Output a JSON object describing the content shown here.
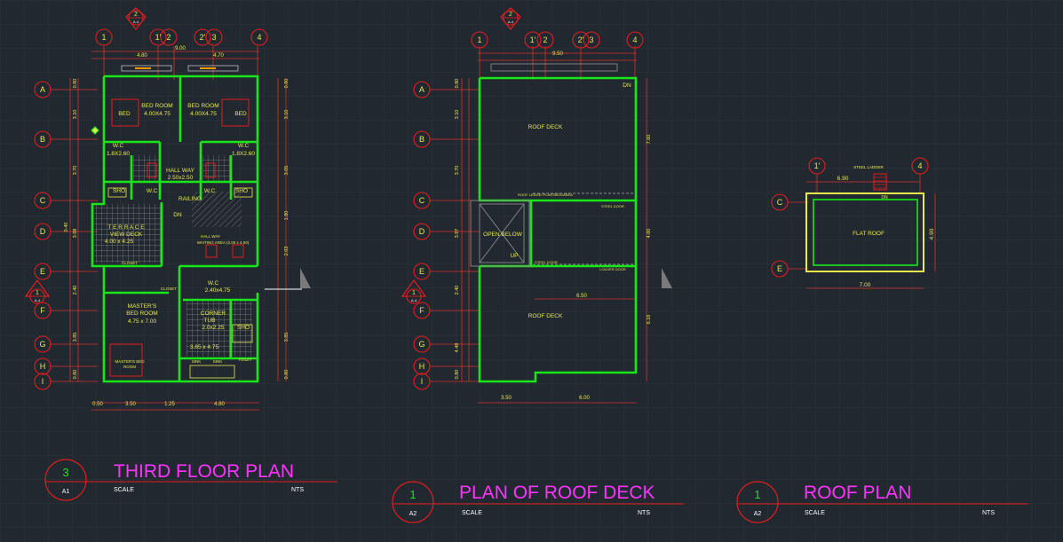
{
  "colors": {
    "background": "#212830",
    "grid": "#2c343d",
    "wall": "#19e619",
    "dimension": "#d4342a",
    "dim_text": "#e8e850",
    "bubble": "#e41d1d",
    "title": "#ff33ff",
    "white": "#ffffff",
    "flat_roof_outline": "#e8e850",
    "hatch": "#8a8a8a"
  },
  "third_floor": {
    "title_number": "3",
    "sheet": "A1",
    "title": "THIRD FLOOR PLAN",
    "scale_label": "SCALE",
    "scale_value": "NTS",
    "section_mark_top": {
      "number": "2",
      "sheet": "A-4"
    },
    "section_mark_side": {
      "number": "1",
      "sheet": "A-4"
    },
    "grid_cols": [
      "1",
      "1'",
      "2",
      "2'",
      "3",
      "4"
    ],
    "grid_rows": [
      "A",
      "B",
      "C",
      "D",
      "E",
      "F",
      "G",
      "H",
      "I"
    ],
    "dims_top": [
      "4.80",
      "9.00",
      "4.70"
    ],
    "dims_bottom": [
      "0.50",
      "3.50",
      "1.25",
      "4.80"
    ],
    "dims_left": [
      "0.80",
      "3.10",
      "3.70",
      "3.98",
      "0.40",
      "2.40",
      "3.85",
      "0.80"
    ],
    "dims_right": [
      "0.80",
      "3.10",
      "3.05",
      "1.80",
      "2.03",
      "3.85",
      "0.80"
    ],
    "rooms": [
      {
        "name": "BED ROOM",
        "size": "4.00X4.75"
      },
      {
        "name": "BED ROOM",
        "size": "4.00X4.75"
      },
      {
        "name": "BED",
        "size": ""
      },
      {
        "name": "BED",
        "size": ""
      },
      {
        "name": "W.C",
        "size": "1.8X2.60"
      },
      {
        "name": "W.C",
        "size": "1.8X2.60"
      },
      {
        "name": "HALL WAY",
        "size": "2.50x2.50"
      },
      {
        "name": "RAILING",
        "size": ""
      },
      {
        "name": "T E R R A C E",
        "size": "VIEW DECK"
      },
      {
        "name": "4.00 x 4.25",
        "size": ""
      },
      {
        "name": "HALL WAY",
        "size": "WAITING AREA (2.00 x 4.00)"
      },
      {
        "name": "W.C",
        "size": "2.40x4.75"
      },
      {
        "name": "MASTER'S",
        "size": "BED ROOM"
      },
      {
        "name": "4.75 x 7.00",
        "size": ""
      },
      {
        "name": "CORNER",
        "size": "TUB"
      },
      {
        "name": "2.0x2.25",
        "size": ""
      },
      {
        "name": "3.85 x 4.75",
        "size": ""
      },
      {
        "name": "MASTER'S BED",
        "size": "ROOM"
      }
    ],
    "small_labels": [
      "SHO",
      "W.C",
      "W.C",
      "SHO",
      "DN",
      "SHO",
      "TOILET",
      "SINK",
      "SINK",
      "CLOSET",
      "CLOSET"
    ]
  },
  "roof_deck": {
    "title_number": "1",
    "sheet": "A2",
    "title": "PLAN OF ROOF DECK",
    "scale_label": "SCALE",
    "scale_value": "NTS",
    "section_mark_top": {
      "number": "2",
      "sheet": "A-4"
    },
    "section_mark_side": {
      "number": "1",
      "sheet": "A-4"
    },
    "grid_cols": [
      "1",
      "1'",
      "2",
      "2'",
      "3",
      "4"
    ],
    "grid_rows": [
      "A",
      "B",
      "C",
      "D",
      "E",
      "F",
      "G",
      "H",
      "I"
    ],
    "dims_top": [
      "9.50"
    ],
    "dims_bottom": [
      "3.50",
      "6.00"
    ],
    "dims_mid": "6.50",
    "dims_left": [
      "0.80",
      "3.10",
      "3.70",
      "3.97",
      "2.40",
      "4.48",
      "0.80"
    ],
    "dims_right": [
      "7.60",
      "4.60",
      "6.16"
    ],
    "labels": {
      "roof_deck_top": "ROOF DECK",
      "roof_deck_bottom": "ROOF DECK",
      "open_below": "OPEN   BELOW",
      "up": "UP",
      "dn": "DN",
      "steel_door": "STEEL DOOR",
      "steel_door2": "STEEL DOOR",
      "louver_door": "LOUVER DOOR",
      "roof_ledge": "ROOF LEDGE/ PLANTBOX/AREA"
    }
  },
  "roof_plan": {
    "title_number": "1",
    "sheet": "A2",
    "title": "ROOF PLAN",
    "scale_label": "SCALE",
    "scale_value": "NTS",
    "grid_cols": [
      "1'",
      "4"
    ],
    "grid_rows": [
      "C",
      "E"
    ],
    "dims_top": "6.90",
    "dims_bottom": "7.00",
    "dims_right": "4.90",
    "labels": {
      "flat_roof": "FLAT ROOF",
      "steel_ladder": "STEEL LADDER",
      "dn": "DN"
    }
  }
}
